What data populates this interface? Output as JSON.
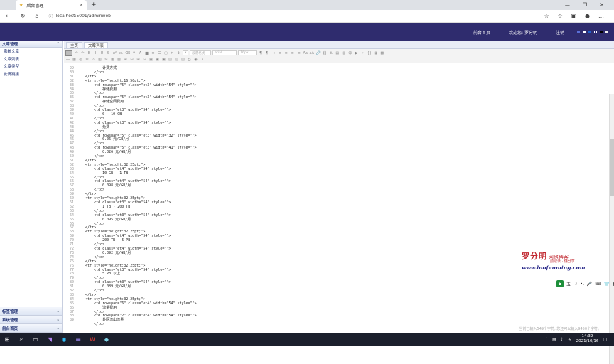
{
  "browser": {
    "tab_title": "后台管理",
    "url": "localhost:5001/adminweb"
  },
  "header": {
    "home_link": "前台首页",
    "welcome": "欢迎您: 罗分明",
    "logout": "注销",
    "theme_colors": [
      "#5a6fd6",
      "#ffffff",
      "#1e62d0",
      "#2a2a8a",
      "#000000",
      "#f0f0f0"
    ]
  },
  "sidebar": {
    "top_section": "文章管理",
    "items": [
      "系统文章",
      "文章列表",
      "文章类型",
      "友情链接"
    ],
    "bottom_sections": [
      "标签管理",
      "系统管理",
      "前台首页"
    ]
  },
  "main": {
    "tabs": [
      "主页",
      "文章列表"
    ],
    "toolbar": {
      "format_placeholder": "段落格式",
      "font_select": "字体",
      "font_name": "arial",
      "font_size": "16px"
    },
    "line_numbers": [
      "29",
      "30",
      "31",
      "32",
      "33",
      "34",
      "35",
      "36",
      "37",
      "38",
      "39",
      "40",
      "41",
      "42",
      "43",
      "44",
      "45",
      "46",
      "47",
      "48",
      "49",
      "50",
      "51",
      "52",
      "53",
      "54",
      "55",
      "56",
      "57",
      "58",
      "59",
      "60",
      "61",
      "62",
      "63",
      "64",
      "65",
      "66",
      "67",
      "68",
      "69",
      "70",
      "71",
      "72",
      "73",
      "74",
      "75",
      "76",
      "77",
      "78",
      "79",
      "80",
      "81",
      "82",
      "83",
      "84",
      "85",
      "86",
      "87",
      "88",
      "89"
    ],
    "code_lines": [
      "            计费方式",
      "        </td>",
      "    </tr>",
      "    <tr style=\"height:16.50pt;\">",
      "        <td rowspan=\"5\" class=\"et3\" width=\"54\" style=\"\">",
      "            存储费用",
      "        </td>",
      "        <td rowspan=\"5\" class=\"et3\" width=\"54\" style=\"\">",
      "            存储空间费用",
      "        </td>",
      "        <td class=\"et3\" width=\"54\" style=\"\">",
      "            0 - 10 GB",
      "        </td>",
      "        <td class=\"et3\" width=\"54\" style=\"\">",
      "            免费",
      "        </td>",
      "        <td rowspan=\"5\" class=\"et3\" width=\"32\" style=\"\">",
      "            0.06 元/GB/月",
      "        </td>",
      "        <td rowspan=\"5\" class=\"et3\" width=\"41\" style=\"\">",
      "            0.026 元/GB/月",
      "        </td>",
      "    </tr>",
      "    <tr style=\"height:32.25pt;\">",
      "        <td class=\"et4\" width=\"54\" style=\"\">",
      "            10 GB - 1 TB",
      "        </td>",
      "        <td class=\"et4\" width=\"54\" style=\"\">",
      "            0.098 元/GB/月",
      "        </td>",
      "    </tr>",
      "    <tr style=\"height:32.25pt;\">",
      "        <td class=\"et3\" width=\"54\" style=\"\">",
      "            1 TB - 200 TB",
      "        </td>",
      "        <td class=\"et3\" width=\"54\" style=\"\">",
      "            0.095 元/GB/月",
      "        </td>",
      "    </tr>",
      "    <tr style=\"height:32.25pt;\">",
      "        <td class=\"et4\" width=\"54\" style=\"\">",
      "            200 TB - 5 PB",
      "        </td>",
      "        <td class=\"et4\" width=\"54\" style=\"\">",
      "            0.092 元/GB/月",
      "        </td>",
      "    </tr>",
      "    <tr style=\"height:32.25pt;\">",
      "        <td class=\"et3\" width=\"54\" style=\"\">",
      "            5 PB 以上",
      "        </td>",
      "        <td class=\"et3\" width=\"54\" style=\"\">",
      "            0.089 元/GB/月",
      "        </td>",
      "    </tr>",
      "    <tr style=\"height:32.25pt;\">",
      "        <td rowspan=\"6\" class=\"et4\" width=\"54\" style=\"\">",
      "            流量费用",
      "        </td>",
      "        <td rowspan=\"2\" class=\"et4\" width=\"54\" style=\"\">",
      "            外网流出流量",
      "        </td>"
    ]
  },
  "watermark": {
    "name": "罗分明",
    "tagline": "网络博客",
    "sub": "勤记录 · 懂分享",
    "site": "www.luofenming.com"
  },
  "ime_bar": {
    "mode": "五"
  },
  "status_bar": {
    "text": "当前已输入549个字符, 您还可以输入9450个字符。"
  },
  "taskbar": {
    "time": "14:32",
    "date": "2021/10/16"
  }
}
